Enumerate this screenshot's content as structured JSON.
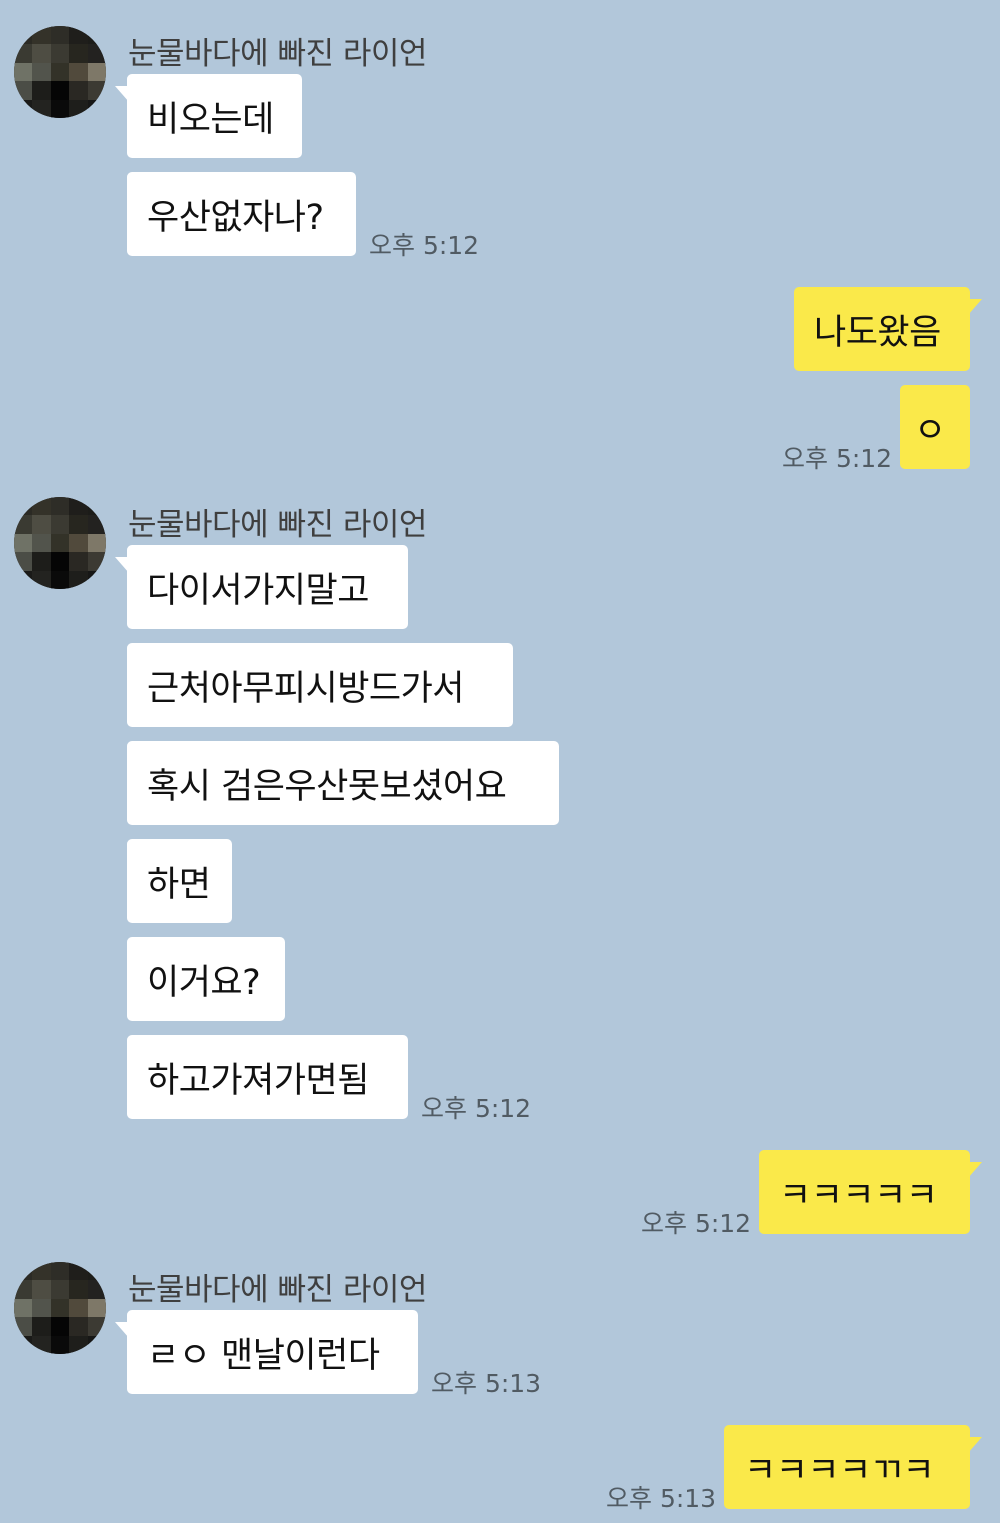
{
  "messages": {
    "g1": {
      "sender": "눈물바다에 빠진 라이언",
      "bubbles": [
        "비오는데",
        "우산없자나?"
      ],
      "time": "오후 5:12"
    },
    "g2": {
      "bubbles": [
        "나도왔음",
        "ㅇ"
      ],
      "time": "오후 5:12"
    },
    "g3": {
      "sender": "눈물바다에 빠진 라이언",
      "bubbles": [
        "다이서가지말고",
        "근처아무피시방드가서",
        "혹시 검은우산못보셨어요",
        "하면",
        "이거요?",
        "하고가져가면됨"
      ],
      "time": "오후 5:12"
    },
    "g4": {
      "bubbles": [
        "ㅋㅋㅋㅋㅋ"
      ],
      "time": "오후 5:12"
    },
    "g5": {
      "sender": "눈물바다에 빠진 라이언",
      "bubbles": [
        "ㄹㅇ 맨날이런다"
      ],
      "time": "오후 5:13"
    },
    "g6": {
      "bubbles": [
        "ㅋㅋㅋㅋㄲㅋ"
      ],
      "time": "오후 5:13"
    }
  },
  "colors": {
    "background": "#b2c7da",
    "incoming_bubble": "#ffffff",
    "outgoing_bubble": "#fae94a"
  },
  "icons": {
    "avatar": "pixelated-profile-avatar"
  }
}
